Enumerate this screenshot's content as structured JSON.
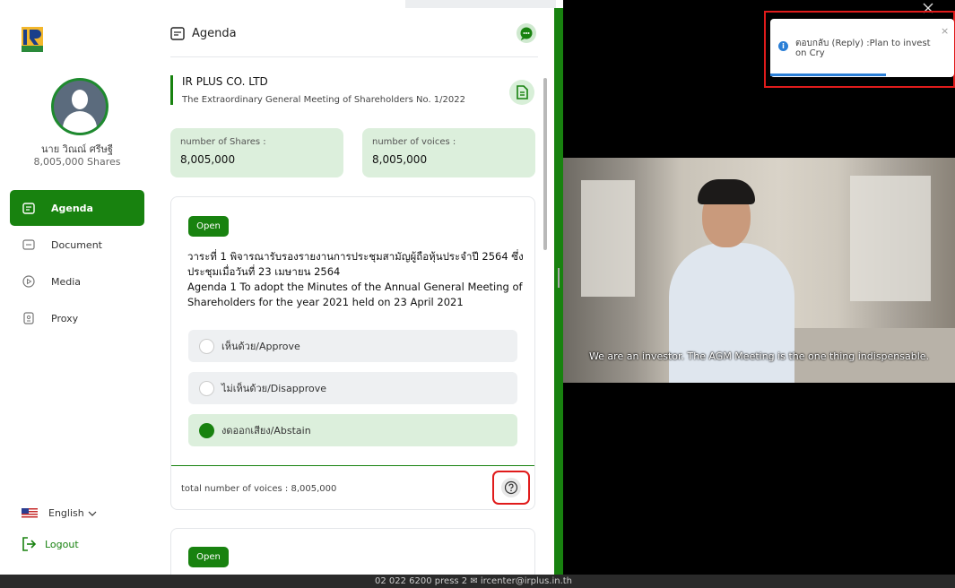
{
  "user": {
    "name": "นาย วิณณ์ ศรีษฐี",
    "shares": "8,005,000 Shares"
  },
  "nav": {
    "items": [
      {
        "label": "Agenda",
        "active": true
      },
      {
        "label": "Document",
        "active": false
      },
      {
        "label": "Media",
        "active": false
      },
      {
        "label": "Proxy",
        "active": false
      }
    ],
    "language": "English",
    "logout": "Logout"
  },
  "panel": {
    "title": "Agenda",
    "company": "IR PLUS CO. LTD",
    "meeting": "The Extraordinary General Meeting of Shareholders No. 1/2022",
    "shares_label": "number of Shares :",
    "shares_value": "8,005,000",
    "voices_label": "number of voices :",
    "voices_value": "8,005,000"
  },
  "agenda1": {
    "status": "Open",
    "text_th": "วาระที่ 1 พิจารณารับรองรายงานการประชุมสามัญผู้ถือหุ้นประจำปี 2564 ซึ่งประชุมเมื่อวันที่ 23 เมษายน 2564",
    "text_en": "Agenda 1 To adopt the Minutes of the Annual General Meeting of Shareholders for the year 2021 held on 23 April 2021",
    "options": [
      {
        "label": "เห็นด้วย/Approve",
        "selected": false
      },
      {
        "label": "ไม่เห็นด้วย/Disapprove",
        "selected": false
      },
      {
        "label": "งดออกเสียง/Abstain",
        "selected": true
      }
    ],
    "total_voices": "total number of voices : 8,005,000"
  },
  "agenda2": {
    "status": "Open"
  },
  "video": {
    "subtitle": "We are an investor. The AGM Meeting is the one thing indispensable."
  },
  "toast": {
    "message": "ตอบกลับ (Reply) :Plan to invest on Cry",
    "close": "×"
  },
  "footer": {
    "text": "02 022 6200 press 2 ✉ ircenter@irplus.in.th"
  },
  "colors": {
    "accent": "#18820f",
    "highlight": "#e01b1b",
    "info": "#2b7fd6"
  }
}
